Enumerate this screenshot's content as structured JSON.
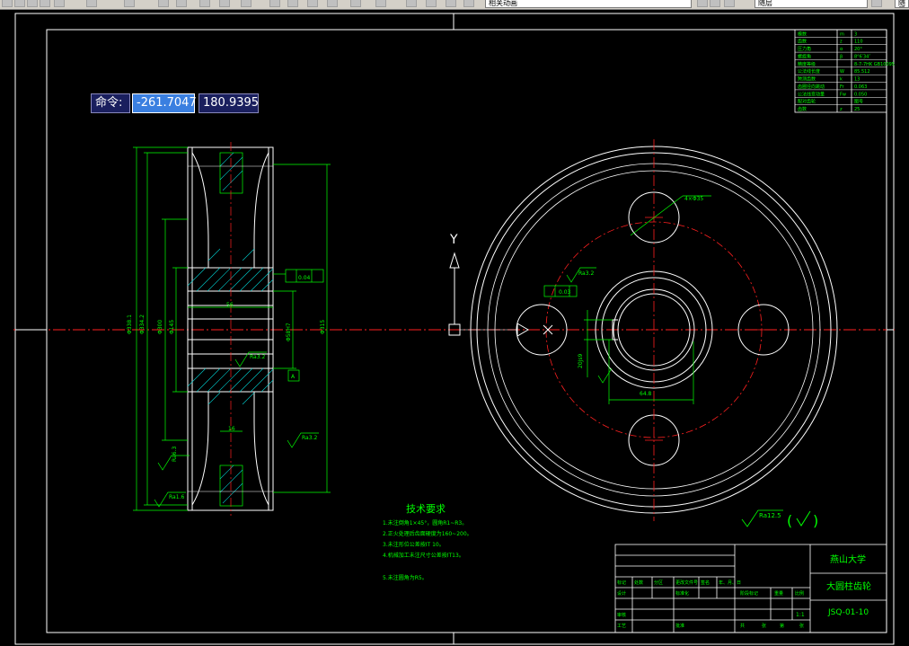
{
  "toolbar": {
    "combo_layer": "相关动画",
    "combo_linetype": "随层",
    "combo_right": "随层"
  },
  "command": {
    "label": "命令:",
    "x_value": "-261.7047",
    "y_value": "180.9395"
  },
  "ucs": {
    "y_label": "Y"
  },
  "tech_requirements": {
    "title": "技术要求",
    "items": [
      "1.未注倒角1×45°，圆角R1~R3。",
      "2.正火处理后齿面硬度为160~200。",
      "3.未注形位公差按IT 10。",
      "4.机械加工未注尺寸公差按IT13。",
      "5.未注圆角为R5。"
    ]
  },
  "title_block": {
    "school": "燕山大学",
    "part_name": "大圆柱齿轮",
    "drawing_no": "JSQ-01-10",
    "scale": "1:1",
    "row_labels": [
      "标记",
      "处数",
      "分区",
      "更改文件号",
      "签名",
      "年、月、日"
    ],
    "design_labels": [
      "设计",
      "标准化",
      "审核",
      "工艺",
      "批准"
    ],
    "stage_labels": [
      "阶段标记",
      "重量",
      "比例"
    ],
    "sheet_labels": [
      "共",
      "张",
      "第",
      "张"
    ]
  },
  "param_table": {
    "rows": [
      [
        "模数",
        "m",
        "3"
      ],
      [
        "齿数",
        "z",
        "110"
      ],
      [
        "压力角",
        "α",
        "20°"
      ],
      [
        "螺旋角",
        "β",
        "8°6′34″"
      ],
      [
        "精度等级",
        "",
        "8-7-7HK GB10095"
      ],
      [
        "公法线长度",
        "W",
        "85.512"
      ],
      [
        "跨测齿数",
        "k",
        "13"
      ],
      [
        "齿圈径向跳动",
        "Fr",
        "0.063"
      ],
      [
        "公法线变动量",
        "Fw",
        "0.050"
      ],
      [
        "配对齿轮",
        "",
        "图号"
      ],
      [
        "齿数",
        "z",
        "25"
      ]
    ]
  },
  "dimensions": {
    "d_outer": "Φ338.1",
    "d_pitch": "Φ334.2",
    "d_hub": "Φ145",
    "d_bore": "Φ70",
    "d_rim": "Φ315",
    "d_inner": "Φ300",
    "width": "56",
    "bore_depth": "Φ58H7",
    "keyway": "20Js9",
    "key_depth": "64.8",
    "hole_dia": "4×Φ35",
    "web": "16",
    "chamfer": "0.1",
    "rough_a": "Ra6.3",
    "rough_b": "Ra3.2",
    "rough_c": "Ra1.6",
    "rough_d": "Ra3.2",
    "rough_general": "Ra12.5",
    "tol_face": "0.04",
    "tol_runout": "0.03",
    "datum_a": "A"
  },
  "colors": {
    "green": "#00ff00",
    "red": "#ff2020",
    "white": "#ffffff"
  }
}
